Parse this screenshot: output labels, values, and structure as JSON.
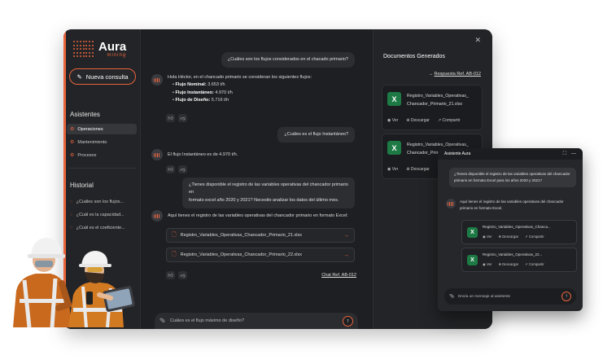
{
  "brand": {
    "name": "Aura",
    "tagline": "mining"
  },
  "sidebar": {
    "new_chat": "Nueva consulta",
    "assistants_title": "Asistentes",
    "assistants": [
      "Operaciones",
      "Mantenimiento",
      "Procesos"
    ],
    "history_title": "Historial",
    "history": [
      "¿Cuáles son los flujos...",
      "¿Cuál es la capacidad...",
      "¿Cuál es el coeficiente..."
    ]
  },
  "chat": {
    "q1": "¿Cuáles son los flujos considerados en el chacado primario?",
    "a1_intro": "Hola Héctor, en el chancado primario se consideran los siguientes flujos:",
    "a1_items": [
      {
        "label": "Flujo Nominal:",
        "value": "3.653 t/h"
      },
      {
        "label": "Flujo Instantáneo:",
        "value": "4.970 t/h"
      },
      {
        "label": "Flujo de Diseño:",
        "value": "5.716 t/h"
      }
    ],
    "q2": "¿Cuáles es el flujo Instantáneo?",
    "a2": "El flujo Instantáneo es de 4.970 t/h.",
    "q3_line1": "¿Tienes disponible el registro de las variables operativas del chancador primario en",
    "q3_line2": "formato excel año 2020 y 2021? Necesito analizar los datos del último mes.",
    "a3": "Aquí tienes el registro de las variables operativas del chancador primario en formato Excel:",
    "files": [
      "Registro_Variables_Operativas_Chancador_Primario_21.xlsx",
      "Registro_Variables_Operativas_Chancador_Primario_22.xlsx"
    ],
    "chat_ref": "Chat Ref. AB-012",
    "input_value": "Cuáles es el flujo máximo de diseño?"
  },
  "docs": {
    "title": "Documentos Generados",
    "ref_prefix": "→",
    "ref_label": "Respuesta Ref. AB-012",
    "cards": [
      {
        "name_line1": "Registro_Variables_Operativas_",
        "name_line2": "Chancador_Primario_21.xlsx"
      },
      {
        "name_line1": "Registro_Variables_Operativas_",
        "name_line2": "Chancador_Prim"
      }
    ],
    "actions": {
      "view": "Ver",
      "download": "Descargar",
      "share": "Compartir"
    }
  },
  "assistant": {
    "title": "Asistente Aura",
    "user_msg": "¿Tienes disponible el registro de las variables operativas del chancador primario en formato Excel para los años 2020 y 2021?",
    "bot_msg": "Aquí tienes el registro de las variables operativas del chancador primario en formato Excel.",
    "files": [
      "Registro_Variables_Operativas_Chanca...",
      "Registro_Variables_Operativas_22..."
    ],
    "input_placeholder": "Envía un mensaje al asistente"
  },
  "colors": {
    "accent": "#e8643c",
    "bg": "#1e1f22",
    "excel": "#1d7a45"
  }
}
